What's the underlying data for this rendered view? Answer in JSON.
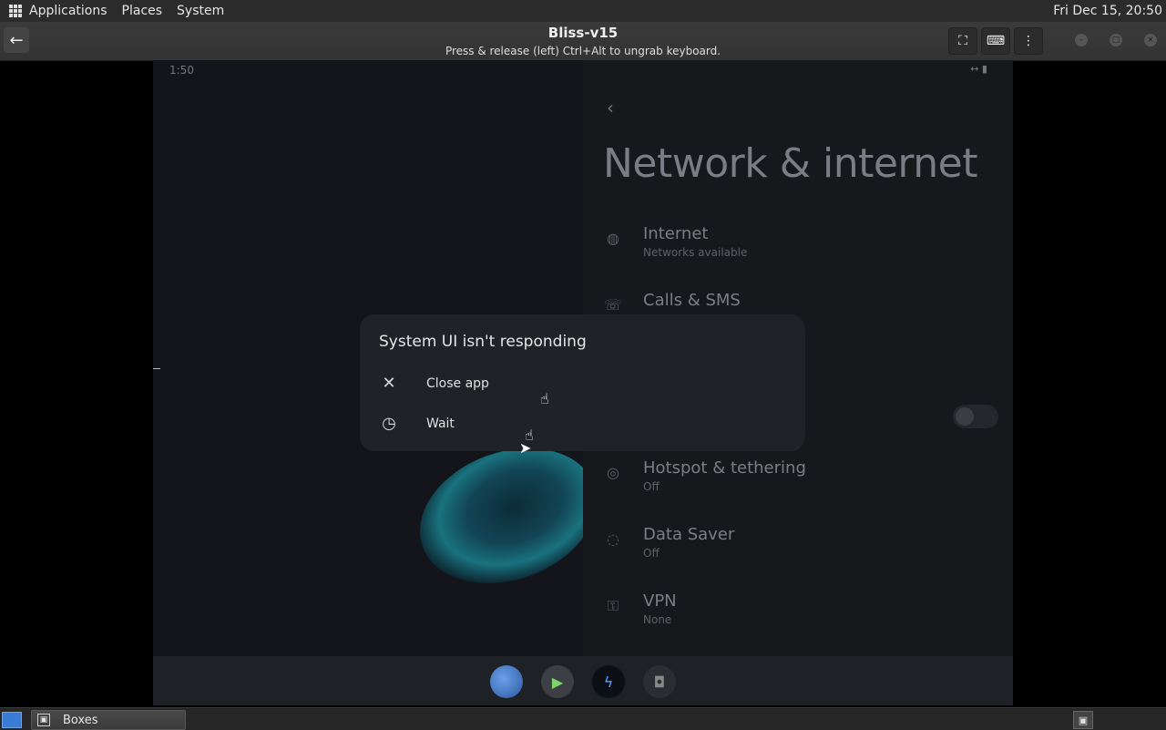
{
  "top_panel": {
    "menus": [
      "Applications",
      "Places",
      "System"
    ],
    "clock": "Fri Dec 15, 20:50"
  },
  "header": {
    "title": "Bliss-v15",
    "subtitle": "Press & release (left) Ctrl+Alt to ungrab keyboard.",
    "back_icon": "arrow-left-icon",
    "buttons": [
      "fullscreen-icon",
      "keyboard-icon",
      "menu-dots-icon"
    ],
    "window_controls": [
      "minimize-icon",
      "maximize-icon",
      "close-icon"
    ]
  },
  "vm": {
    "status_time": "1:50",
    "settings": {
      "title": "Network & internet",
      "items": [
        {
          "title": "Internet",
          "subtitle": "Networks available",
          "icon": "globe-question-icon"
        },
        {
          "title": "Calls & SMS",
          "subtitle": "",
          "icon": "phone-icon"
        },
        {
          "title": "Hotspot & tethering",
          "subtitle": "Off",
          "icon": "hotspot-icon"
        },
        {
          "title": "Data Saver",
          "subtitle": "Off",
          "icon": "data-saver-icon"
        },
        {
          "title": "VPN",
          "subtitle": "None",
          "icon": "vpn-key-icon"
        }
      ]
    },
    "dialog": {
      "title": "System UI isn't responding",
      "options": [
        {
          "label": "Close app",
          "icon": "close-icon"
        },
        {
          "label": "Wait",
          "icon": "clock-icon"
        }
      ]
    },
    "dock": [
      "gallery-icon",
      "play-store-icon",
      "bolt-app-icon",
      "camera-icon"
    ]
  },
  "taskbar": {
    "items": [
      {
        "label": "Boxes"
      }
    ]
  }
}
